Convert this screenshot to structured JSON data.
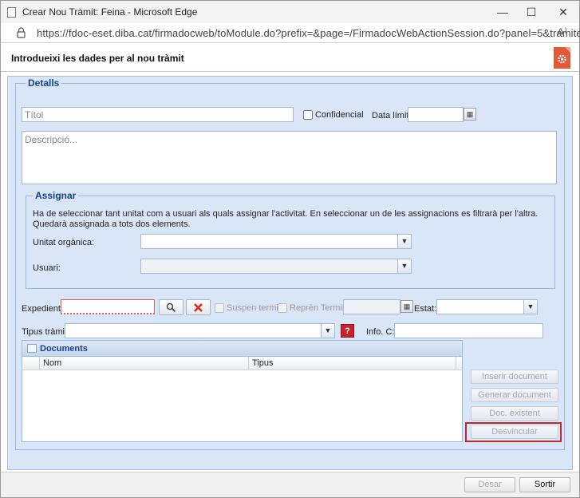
{
  "browser": {
    "window_title": "Crear Nou Tràmit: Feina - Microsoft Edge",
    "url": "https://fdoc-eset.diba.cat/firmadocweb/toModule.do?prefix=&page=/FirmadocWebActionSession.do?panel=5&tramite...",
    "minimize": "—",
    "maximize": "☐",
    "close": "✕",
    "reader_icon": "A⁾"
  },
  "dialog": {
    "title": "Introdueixi les dades per al nou tràmit"
  },
  "details": {
    "legend": "Detalls",
    "title_placeholder": "Títol",
    "confidential_label": "Confidencial",
    "deadline_label": "Data límit",
    "description_placeholder": "Descripció..."
  },
  "assign": {
    "legend": "Assignar",
    "info": "Ha de seleccionar tant unitat com a usuari als quals assignar l'activitat. En seleccionar un de les assignacions es filtrarà per l'altra. Quedarà assignada a tots dos elements.",
    "unit_label": "Unitat orgànica:",
    "user_label": "Usuari:"
  },
  "expedient": {
    "label": "Expedient:",
    "suspend_label": "Suspen termini",
    "resume_label": "Reprèn Termini",
    "status_label": "Estat:"
  },
  "tipus": {
    "label": "Tipus tràmit",
    "help": "?",
    "info_label": "Info. C:"
  },
  "documents": {
    "title": "Documents",
    "columns": [
      "Nom",
      "Tipus"
    ],
    "buttons": {
      "insert": "Inserir document",
      "generate": "Generar document",
      "existing": "Doc. existent",
      "unlink": "Desvincular"
    }
  },
  "footer": {
    "submit": "Desar",
    "exit": "Sortir"
  },
  "colors": {
    "panel_bg": "#d9e6f7",
    "legend_text": "#15428b",
    "highlight": "#c0282e",
    "required_border": "#e06060"
  }
}
